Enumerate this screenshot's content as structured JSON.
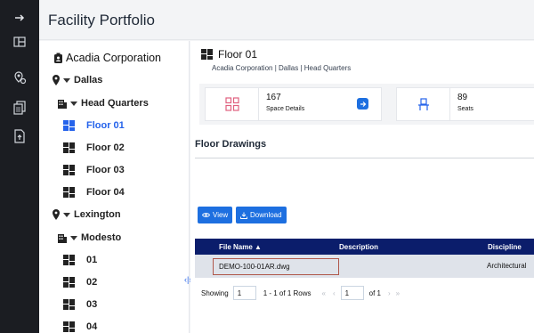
{
  "rail": {
    "icons": [
      "arrow-right-icon",
      "layout-icon",
      "location-settings-icon",
      "documents-icon",
      "upload-document-icon"
    ]
  },
  "header": {
    "title": "Facility Portfolio"
  },
  "tree": {
    "root": "Acadia Corporation",
    "nodes": [
      {
        "label": "Dallas"
      },
      {
        "label": "Head Quarters"
      },
      {
        "label": "Floor 01"
      },
      {
        "label": "Floor 02"
      },
      {
        "label": "Floor 03"
      },
      {
        "label": "Floor 04"
      },
      {
        "label": "Lexington"
      },
      {
        "label": "Modesto"
      },
      {
        "label": "01"
      },
      {
        "label": "02"
      },
      {
        "label": "03"
      },
      {
        "label": "04"
      }
    ]
  },
  "floor": {
    "title": "Floor 01",
    "breadcrumb": "Acadia Corporation | Dallas | Head Quarters"
  },
  "stats": {
    "space_value": "167",
    "space_label": "Space Details",
    "seats_value": "89",
    "seats_label": "Seats",
    "accent_pink": "#e0607e",
    "accent_blue": "#2563eb"
  },
  "drawings": {
    "title": "Floor Drawings",
    "view_label": "View",
    "download_label": "Download",
    "columns": [
      "File Name ▲",
      "Description",
      "Discipline"
    ],
    "rows": [
      {
        "file": "DEMO-100-01AR.dwg",
        "description": "",
        "discipline": "Architectural"
      }
    ]
  },
  "pager": {
    "showing_label": "Showing",
    "page_size": "1",
    "rows_text": "1 - 1 of 1 Rows",
    "first": "«",
    "prev": "‹",
    "page": "1",
    "of_text": "of 1",
    "next": "›",
    "last": "»"
  },
  "colors": {
    "rail": "#1b1d22",
    "grid_header": "#0b1d6b",
    "button": "#1d6fe0",
    "selected_row": "#dfe3ea"
  }
}
